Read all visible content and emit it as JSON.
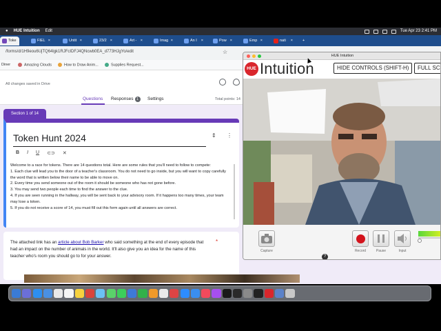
{
  "menubar": {
    "app": "HUE Intuition",
    "menu": "Edit",
    "clock": "Tue Apr 23  2:41 PM"
  },
  "browser": {
    "tabs": [
      "Toke",
      "FIEL",
      "Untit",
      "23/2",
      "Art -",
      "Imag",
      "An I",
      "Pow",
      "Emp",
      "nati"
    ],
    "url": "/forms/d/1H9eou6UjTQ64lgk1RJFcIDFJ4QNcwb0EA_d773HJgYo/edit",
    "bookmarks": [
      "Diner",
      "Amazing Clouds",
      "How to Draw Anim...",
      "Supplies Request..."
    ]
  },
  "form": {
    "saved": "All changes saved in Drive",
    "tabs": {
      "questions": "Questions",
      "responses": "Responses",
      "responses_count": "1",
      "settings": "Settings"
    },
    "total_points": "Total points: 14",
    "section_tag": "Section 1 of 14",
    "title": "Token Hunt 2024",
    "description": [
      "Welcome to a race for tokens. There are 14 questions total. Here are some rules that you'll need to follow to compete:",
      "1. Each clue will lead you to the door of a teacher's classroom. You do not need to go inside, but you will want to copy carefully the word that is written below their name to be able to move on.",
      "2. Every time you send someone out of the room it should be someone who has not gone before.",
      "3. You may send two people each time to find the answer to the clue.",
      "4. If you are seen running in the hallway, you will be sent back to your advisory room. If it happens too many times, your team may lose a token.",
      "5. If you do not receive a score of 14, you must fill out this form again until all answers are correct."
    ],
    "question": {
      "before_link": "The attached link has an ",
      "link": "article about Bob Barker",
      "after_link": " who said something at the end of every episode that had an impact on the number of animals in the world. It'll also give you an idea for the name of this teacher who's room you should go to for your answer.",
      "required_mark": "*"
    }
  },
  "hue": {
    "window_title": "HUE Intuition",
    "logo_text": "HUE",
    "brand_word": "Intuition",
    "hide_controls": "HIDE CONTROLS (SHIFT-H)",
    "full_screen": "FULL SC",
    "controls": [
      "Capture",
      "Record",
      "Pause",
      "Input"
    ],
    "help": "?"
  },
  "colors": {
    "form_accent": "#673ab7",
    "hue_red": "#d9262c",
    "tab_bar": "#1e4d8c"
  }
}
